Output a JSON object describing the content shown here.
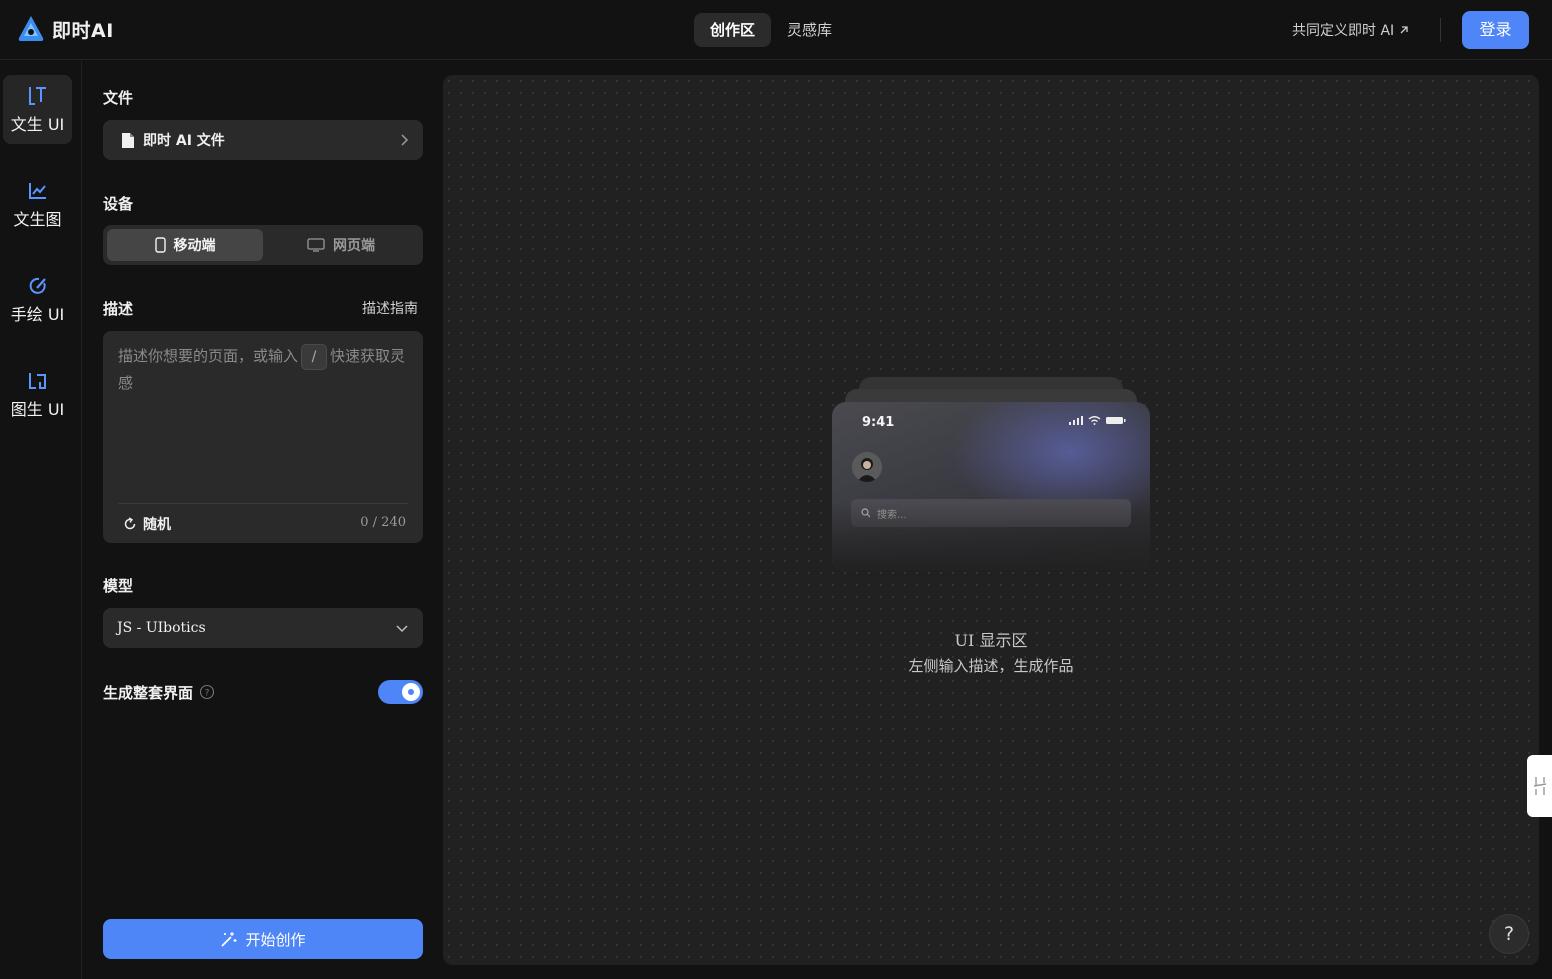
{
  "app": {
    "name": "即时AI"
  },
  "topbar": {
    "tabs": [
      {
        "label": "创作区"
      },
      {
        "label": "灵感库"
      }
    ],
    "define_link": "共同定义即时 AI",
    "login": "登录"
  },
  "rail": {
    "items": [
      {
        "label": "文生 UI",
        "icon": "text-ui-icon"
      },
      {
        "label": "文生图",
        "icon": "chart-icon"
      },
      {
        "label": "手绘 UI",
        "icon": "sketch-icon"
      },
      {
        "label": "图生 UI",
        "icon": "image-ui-icon"
      }
    ]
  },
  "panel": {
    "file_title": "文件",
    "file_value": "即时 AI 文件",
    "device_title": "设备",
    "device_options": [
      "移动端",
      "网页端"
    ],
    "desc_title": "描述",
    "desc_guide": "描述指南",
    "desc_placeholder_before": "描述你想要的页面，或输入",
    "desc_placeholder_key": "/",
    "desc_placeholder_after": "快速获取灵感",
    "random_label": "随机",
    "counter": "0 / 240",
    "model_title": "模型",
    "model_value": "JS - UIbotics",
    "toggle_label": "生成整套界面",
    "toggle_on": true,
    "start_label": "开始创作"
  },
  "canvas": {
    "preview": {
      "time": "9:41",
      "search_placeholder": "搜索..."
    },
    "title": "UI 显示区",
    "subtitle": "左侧输入描述，生成作品",
    "help": "?"
  },
  "colors": {
    "accent": "#4f86f7",
    "background": "#121212",
    "surface": "#2a2a2a"
  }
}
